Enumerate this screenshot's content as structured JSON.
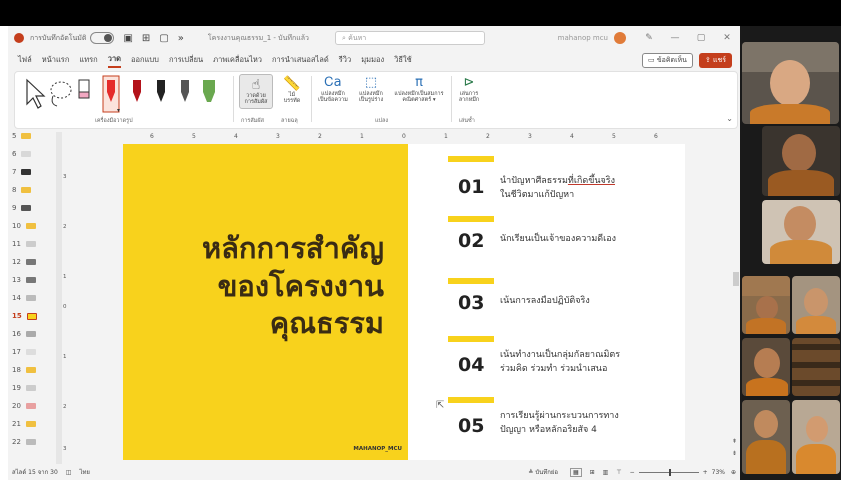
{
  "titlebar": {
    "autosave_label": "การบันทึกอัตโนมัติ",
    "doc_title": "โครงงานคุณธรรม_1 - บันทึกแล้ว",
    "search_placeholder": "ค้นหา",
    "user_name": "mahanop mcu"
  },
  "menu": {
    "tabs": [
      "ไฟล์",
      "หน้าแรก",
      "แทรก",
      "วาด",
      "ออกแบบ",
      "การเปลี่ยน",
      "ภาพเคลื่อนไหว",
      "การนำเสนอสไลด์",
      "รีวิว",
      "มุมมอง",
      "วิธีใช้"
    ],
    "active_tab": "วาด",
    "comment_label": "ข้อคิดเห็น",
    "share_label": "แชร์"
  },
  "ribbon": {
    "group_tools": "เครื่องมือวาดรูป",
    "draw_with_touch": [
      "วาดด้วย",
      "การสัมผัส"
    ],
    "ruler": [
      "ไม้",
      "บรรทัด"
    ],
    "group_touch": "การสัมผัส",
    "group_stencils": "ลายฉลุ",
    "convert_text": [
      "แปลงหมึก",
      "เป็นข้อความ"
    ],
    "convert_shape": [
      "แปลงหมึก",
      "เป็นรูปร่าง"
    ],
    "convert_math": [
      "แปลงหมึกเป็นสมการ",
      "คณิตศาสตร์ ▾"
    ],
    "group_convert": "แปลง",
    "replay": [
      "เล่นการ",
      "ลากหมึก"
    ],
    "group_replay": "เล่นซ้ำ"
  },
  "ruler": {
    "h_ticks": [
      "6",
      "5",
      "4",
      "3",
      "2",
      "1",
      "0",
      "1",
      "2",
      "3",
      "4",
      "5",
      "6"
    ],
    "v_ticks": [
      "3",
      "2",
      "1",
      "0",
      "1",
      "2",
      "3"
    ]
  },
  "thumbnails": [
    "5",
    "6",
    "7",
    "8",
    "9",
    "10",
    "11",
    "12",
    "13",
    "14",
    "15",
    "16",
    "17",
    "18",
    "19",
    "20",
    "21",
    "22"
  ],
  "selected_slide": "15",
  "slide": {
    "title_lines": [
      "หลักการสำคัญ",
      "ของโครงงาน",
      "คุณธรรม"
    ],
    "footer": "MAHANOP_MCU",
    "items": [
      {
        "num": "01",
        "line1_pre": "นำปัญหาศีลธรรม",
        "line1_underlined": "ที่เกิดขึ้นจริง",
        "line2": "ในชีวิตมาแก้ปัญหา"
      },
      {
        "num": "02",
        "line1_pre": "นักเรียนเป็นเจ้าของความดีเอง",
        "line1_underlined": "",
        "line2": ""
      },
      {
        "num": "03",
        "line1_pre": "เน้นการลงมือปฏิบัติจริง",
        "line1_underlined": "",
        "line2": ""
      },
      {
        "num": "04",
        "line1_pre": "เน้นทำงานเป็นกลุ่มกัลยาณมิตร",
        "line1_underlined": "",
        "line2": "ร่วมคิด ร่วมทำ ร่วมนำเสนอ"
      },
      {
        "num": "05",
        "line1_pre": "การเรียนรู้ผ่านกระบวนการทาง",
        "line1_underlined": "",
        "line2": "ปัญญา หรือหลักอริยสัจ 4"
      }
    ]
  },
  "status": {
    "slide_pos": "สไลด์ 15 จาก 30",
    "language": "ไทย",
    "notes": "บันทึกย่อ",
    "zoom": "73%"
  },
  "colors": {
    "accent": "#c43e1c",
    "slide_yellow": "#f8d21c",
    "title_text": "#3a2c14"
  }
}
